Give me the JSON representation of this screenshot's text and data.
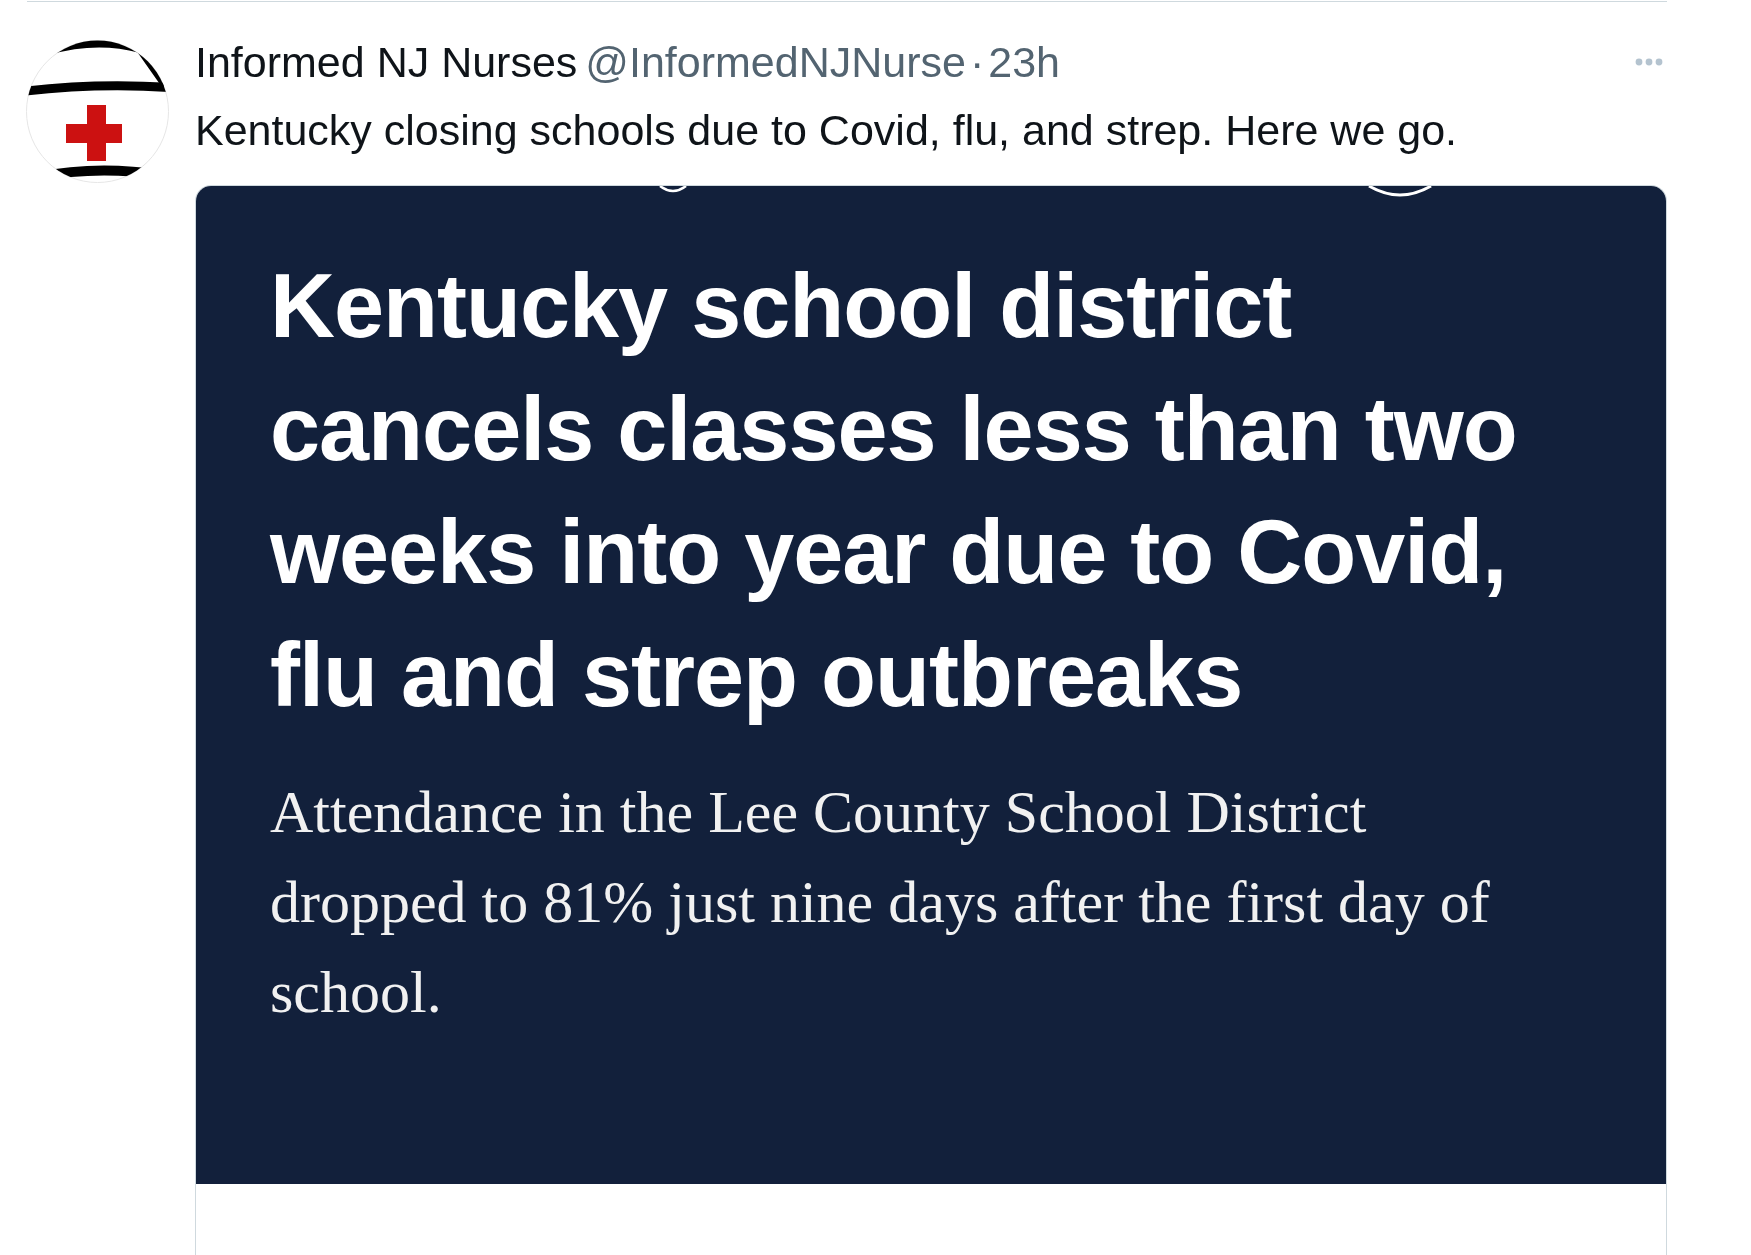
{
  "tweet": {
    "author": {
      "name": "Informed NJ Nurses",
      "handle": "@InformedNJNurse"
    },
    "separator": "·",
    "time": "23h",
    "text": "Kentucky closing schools due to Covid, flu, and strep. Here we go.",
    "media": {
      "headline": "Kentucky school district cancels classes less than two weeks into year due to Covid, flu and strep outbreaks",
      "summary": "Attendance in the Lee County School District dropped to 81% just nine days after the first day of school."
    }
  }
}
